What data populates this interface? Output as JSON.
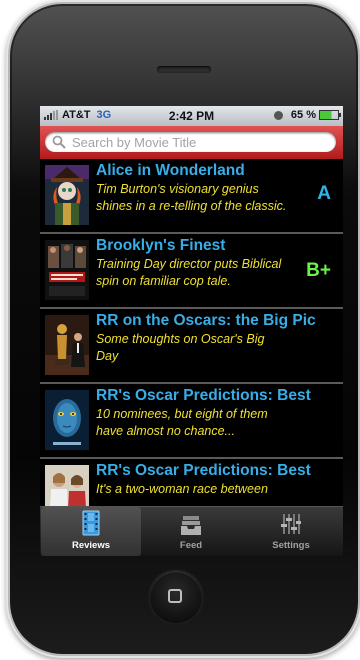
{
  "status_bar": {
    "carrier": "AT&T",
    "network": "3G",
    "time": "2:42 PM",
    "battery": "65 %",
    "battery_level": 0.65
  },
  "search": {
    "placeholder": "Search by Movie Title",
    "value": ""
  },
  "reviews": [
    {
      "title": "Alice in Wonderland",
      "blurb_line1": "Tim Burton's visionary genius",
      "blurb_line2": "shines in a re-telling of the classic.",
      "grade": "A",
      "grade_color": "#2fb4e8",
      "poster_icon": "alice-poster"
    },
    {
      "title": "Brooklyn's Finest",
      "blurb_line1": "Training Day director puts Biblical",
      "blurb_line2": "spin on familiar cop tale.",
      "grade": "B+",
      "grade_color": "#6ef04a",
      "poster_icon": "brooklyns-finest-poster"
    },
    {
      "title": "RR on the Oscars: the Big Pic",
      "blurb_line1": "Some thoughts on Oscar's Big",
      "blurb_line2": "Day",
      "grade": "",
      "grade_color": "",
      "poster_icon": "oscar-statue-poster"
    },
    {
      "title": "RR's Oscar Predictions: Best",
      "blurb_line1": "10 nominees, but eight of them",
      "blurb_line2": "have almost no chance...",
      "grade": "",
      "grade_color": "",
      "poster_icon": "avatar-poster"
    },
    {
      "title": "RR's Oscar Predictions: Best",
      "blurb_line1": "It's a two-woman race between",
      "blurb_line2": "",
      "grade": "",
      "grade_color": "",
      "poster_icon": "actress-poster"
    }
  ],
  "tabbar": {
    "tabs": [
      {
        "label": "Reviews",
        "icon": "film-strip-icon",
        "active": true
      },
      {
        "label": "Feed",
        "icon": "inbox-tray-icon",
        "active": false
      },
      {
        "label": "Settings",
        "icon": "sliders-icon",
        "active": false
      }
    ]
  },
  "colors": {
    "search_bar": "#c62b2b",
    "title": "#38aee8",
    "blurb": "#f0e030"
  }
}
